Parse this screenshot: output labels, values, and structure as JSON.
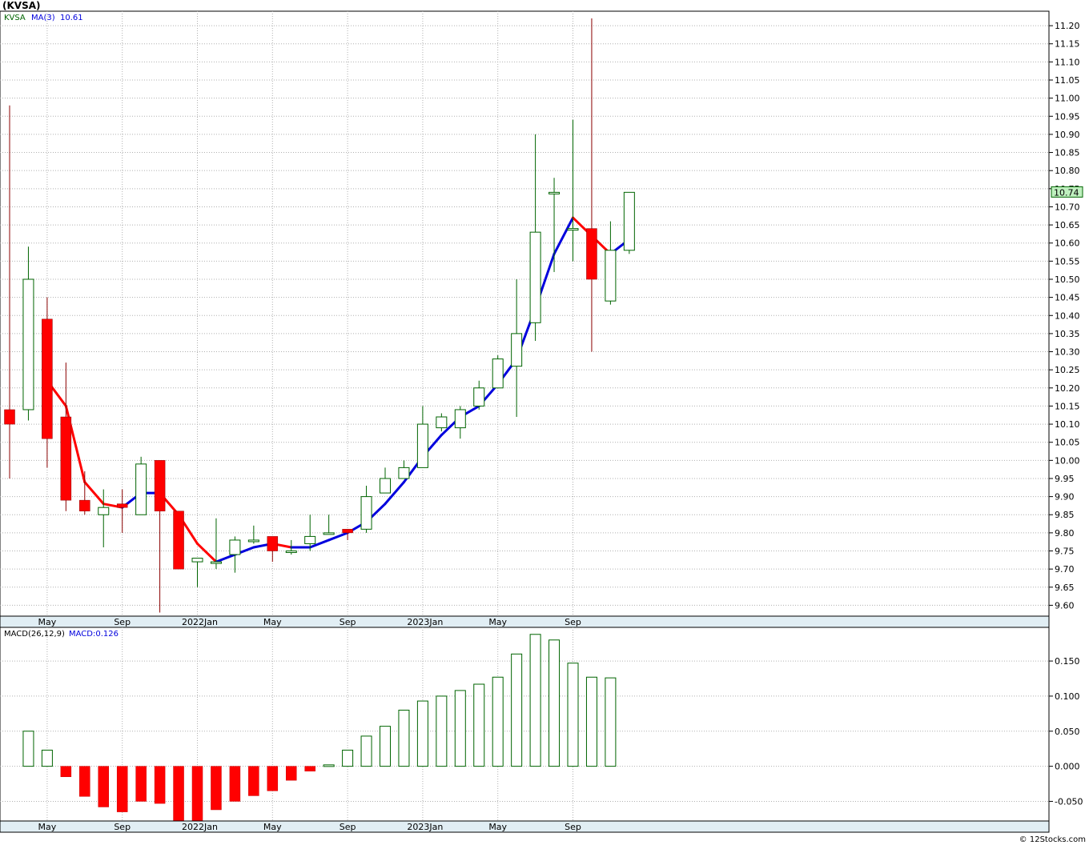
{
  "header": {
    "symbol_title": "(KVSA)",
    "legend_symbol": "KVSA",
    "legend_ma_label": "MA(3)",
    "legend_ma_value": "10.61",
    "macd_label": "MACD(26,12,9)",
    "macd_value_label": "MACD:0.126",
    "last_price_label": "10.74",
    "footer": "© 12Stocks.com"
  },
  "colors": {
    "up": "#006400",
    "down": "#ff0000",
    "ma_up": "#0000dd",
    "ma_down": "#ff0000",
    "grid": "#b0b0b0",
    "axis_band": "#e1eef4",
    "last_price_bg": "#bff0bf"
  },
  "chart_data": [
    {
      "type": "candlestick",
      "title": "(KVSA)",
      "interval": "monthly",
      "x_labels": [
        "May",
        "Sep",
        "2022Jan",
        "May",
        "Sep",
        "2023Jan",
        "May",
        "Sep"
      ],
      "y_ticks": [
        "9.60",
        "9.65",
        "9.70",
        "9.75",
        "9.80",
        "9.85",
        "9.90",
        "9.95",
        "10.00",
        "10.05",
        "10.10",
        "10.15",
        "10.20",
        "10.25",
        "10.30",
        "10.35",
        "10.40",
        "10.45",
        "10.50",
        "10.55",
        "10.60",
        "10.65",
        "10.70",
        "10.75",
        "10.80",
        "10.85",
        "10.90",
        "10.95",
        "11.00",
        "11.05",
        "11.10",
        "11.15",
        "11.20"
      ],
      "ylim": [
        9.57,
        11.24
      ],
      "grid": true,
      "legend": "top-left",
      "candles": [
        {
          "o": 10.14,
          "h": 10.98,
          "l": 9.95,
          "c": 10.1
        },
        {
          "o": 10.14,
          "h": 10.59,
          "l": 10.11,
          "c": 10.5
        },
        {
          "o": 10.39,
          "h": 10.45,
          "l": 9.98,
          "c": 10.06
        },
        {
          "o": 10.12,
          "h": 10.27,
          "l": 9.86,
          "c": 9.89
        },
        {
          "o": 9.89,
          "h": 9.97,
          "l": 9.85,
          "c": 9.86
        },
        {
          "o": 9.85,
          "h": 9.92,
          "l": 9.76,
          "c": 9.87
        },
        {
          "o": 9.88,
          "h": 9.92,
          "l": 9.8,
          "c": 9.87
        },
        {
          "o": 9.85,
          "h": 10.01,
          "l": 9.85,
          "c": 9.99
        },
        {
          "o": 10.0,
          "h": 10.0,
          "l": 9.58,
          "c": 9.86
        },
        {
          "o": 9.86,
          "h": 9.86,
          "l": 9.7,
          "c": 9.7
        },
        {
          "o": 9.72,
          "h": 9.73,
          "l": 9.65,
          "c": 9.73
        },
        {
          "o": 9.72,
          "h": 9.84,
          "l": 9.7,
          "c": 9.72
        },
        {
          "o": 9.74,
          "h": 9.79,
          "l": 9.69,
          "c": 9.78
        },
        {
          "o": 9.78,
          "h": 9.82,
          "l": 9.77,
          "c": 9.78
        },
        {
          "o": 9.79,
          "h": 9.79,
          "l": 9.72,
          "c": 9.75
        },
        {
          "o": 9.75,
          "h": 9.78,
          "l": 9.74,
          "c": 9.75
        },
        {
          "o": 9.77,
          "h": 9.85,
          "l": 9.75,
          "c": 9.79
        },
        {
          "o": 9.8,
          "h": 9.85,
          "l": 9.8,
          "c": 9.8
        },
        {
          "o": 9.81,
          "h": 9.81,
          "l": 9.78,
          "c": 9.8
        },
        {
          "o": 9.81,
          "h": 9.93,
          "l": 9.8,
          "c": 9.9
        },
        {
          "o": 9.91,
          "h": 9.98,
          "l": 9.91,
          "c": 9.95
        },
        {
          "o": 9.95,
          "h": 10.0,
          "l": 9.95,
          "c": 9.98
        },
        {
          "o": 9.98,
          "h": 10.15,
          "l": 9.98,
          "c": 10.1
        },
        {
          "o": 10.09,
          "h": 10.13,
          "l": 10.08,
          "c": 10.12
        },
        {
          "o": 10.09,
          "h": 10.15,
          "l": 10.06,
          "c": 10.14
        },
        {
          "o": 10.15,
          "h": 10.22,
          "l": 10.14,
          "c": 10.2
        },
        {
          "o": 10.2,
          "h": 10.29,
          "l": 10.2,
          "c": 10.28
        },
        {
          "o": 10.26,
          "h": 10.5,
          "l": 10.12,
          "c": 10.35
        },
        {
          "o": 10.38,
          "h": 10.9,
          "l": 10.33,
          "c": 10.63
        },
        {
          "o": 10.74,
          "h": 10.78,
          "l": 10.52,
          "c": 10.74
        },
        {
          "o": 10.64,
          "h": 10.94,
          "l": 10.55,
          "c": 10.64
        },
        {
          "o": 10.64,
          "h": 11.22,
          "l": 10.3,
          "c": 10.5
        },
        {
          "o": 10.44,
          "h": 10.66,
          "l": 10.43,
          "c": 10.58
        },
        {
          "o": 10.58,
          "h": 10.74,
          "l": 10.57,
          "c": 10.74
        }
      ],
      "ma3": [
        null,
        null,
        10.22,
        10.15,
        9.94,
        9.88,
        9.87,
        9.91,
        9.91,
        9.85,
        9.77,
        9.72,
        9.74,
        9.76,
        9.77,
        9.76,
        9.76,
        9.78,
        9.8,
        9.83,
        9.88,
        9.94,
        10.01,
        10.07,
        10.12,
        10.15,
        10.21,
        10.28,
        10.42,
        10.57,
        10.67,
        10.62,
        10.57,
        10.61
      ]
    },
    {
      "type": "bar",
      "title": "MACD(26,12,9)",
      "x_labels": [
        "May",
        "Sep",
        "2022Jan",
        "May",
        "Sep",
        "2023Jan",
        "May",
        "Sep"
      ],
      "y_ticks": [
        "-0.050",
        "0.000",
        "0.050",
        "0.100",
        "0.150"
      ],
      "ylim": [
        -0.078,
        0.198
      ],
      "values": [
        null,
        0.05,
        0.023,
        -0.015,
        -0.043,
        -0.058,
        -0.065,
        -0.05,
        -0.053,
        -0.078,
        -0.078,
        -0.062,
        -0.05,
        -0.042,
        -0.035,
        -0.02,
        -0.007,
        0.002,
        0.023,
        0.043,
        0.057,
        0.08,
        0.093,
        0.1,
        0.108,
        0.117,
        0.127,
        0.16,
        0.188,
        0.18,
        0.147,
        0.127,
        0.126
      ]
    }
  ]
}
